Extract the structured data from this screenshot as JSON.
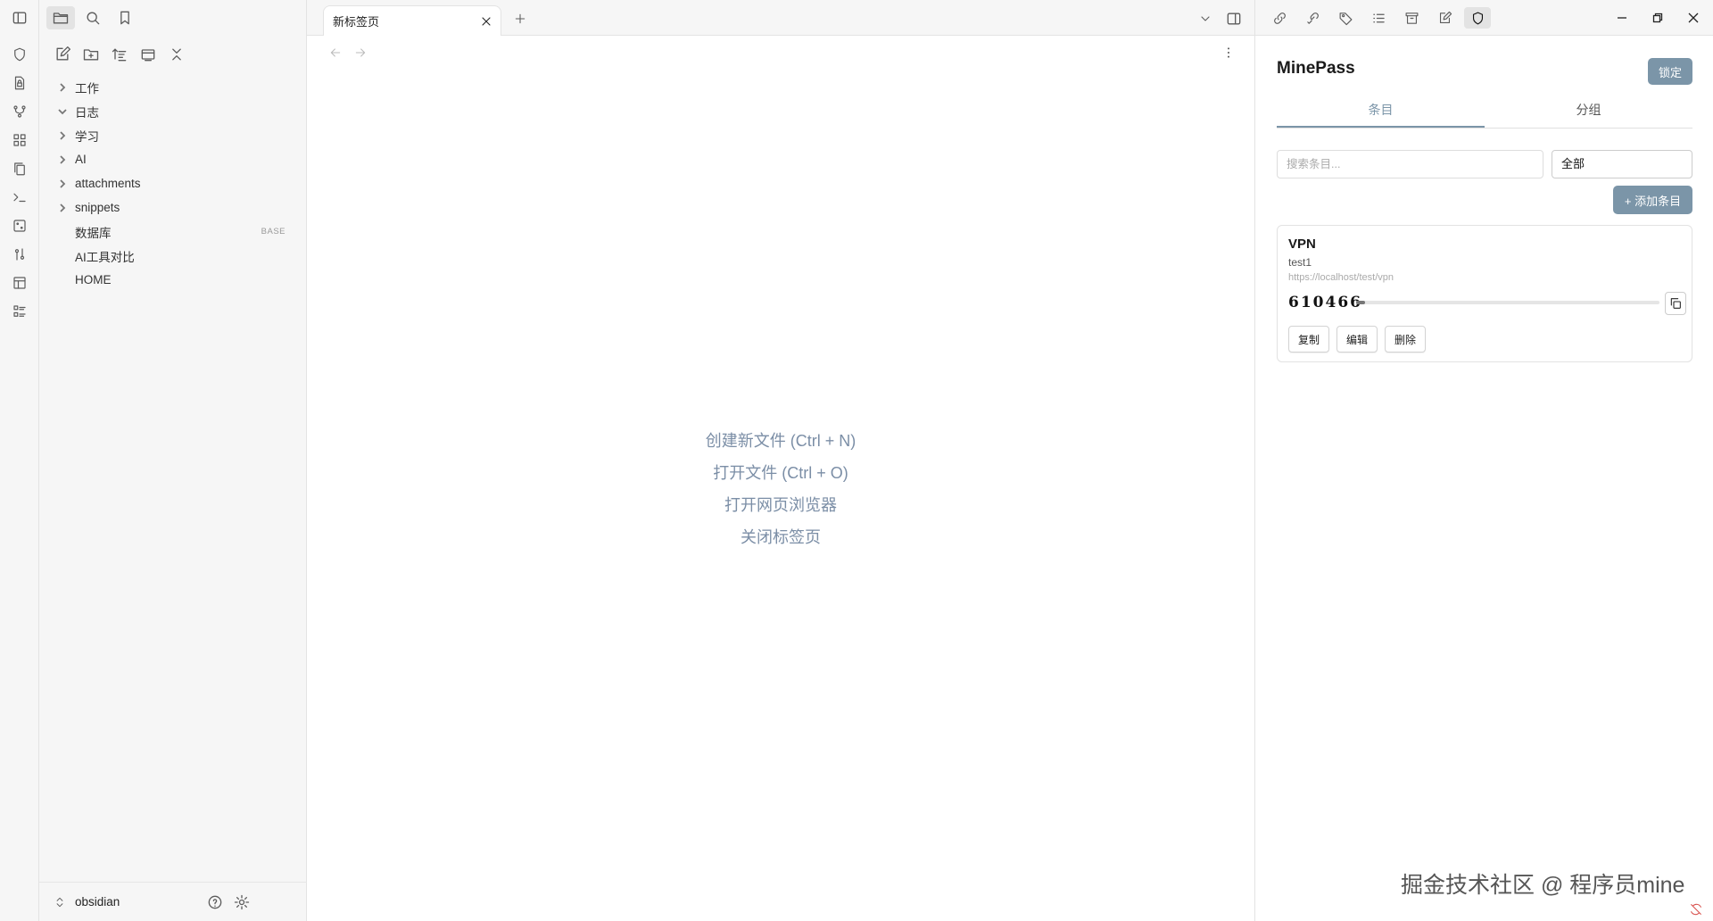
{
  "ribbon": {
    "icons": [
      "shield-outline-icon",
      "file-lock-icon",
      "git-graph-icon",
      "grid-icon",
      "copy-files-icon",
      "terminal-icon",
      "dice-icon",
      "sliders-icon",
      "layout-icon",
      "checklist-icon"
    ]
  },
  "sidebar": {
    "top_icons": [
      "sidebar-toggle-icon",
      "folder-icon",
      "search-icon",
      "bookmark-icon"
    ],
    "action_icons": [
      "new-note-icon",
      "new-folder-icon",
      "sort-icon",
      "collapse-view-icon",
      "collapse-all-icon"
    ],
    "tree": [
      {
        "label": "工作",
        "type": "folder",
        "expanded": false
      },
      {
        "label": "日志",
        "type": "folder",
        "expanded": true
      },
      {
        "label": "学习",
        "type": "folder",
        "expanded": false
      },
      {
        "label": "AI",
        "type": "folder",
        "expanded": false
      },
      {
        "label": "attachments",
        "type": "folder",
        "expanded": false
      },
      {
        "label": "snippets",
        "type": "folder",
        "expanded": false
      },
      {
        "label": "数据库",
        "type": "file",
        "badge": "BASE"
      },
      {
        "label": "AI工具对比",
        "type": "file"
      },
      {
        "label": "HOME",
        "type": "file"
      }
    ],
    "vault_name": "obsidian"
  },
  "main": {
    "tab_title": "新标签页",
    "empty_actions": [
      "创建新文件 (Ctrl + N)",
      "打开文件 (Ctrl + O)",
      "打开网页浏览器",
      "关闭标签页"
    ]
  },
  "right_panel": {
    "top_icons": [
      "link-key-icon",
      "link-check-icon",
      "tag-icon",
      "list-icon",
      "archive-icon",
      "edit-icon",
      "shield-icon"
    ],
    "title": "MinePass",
    "lock_label": "锁定",
    "tabs": [
      "条目",
      "分组"
    ],
    "search_placeholder": "搜索条目...",
    "group_selected": "全部",
    "add_label": "+ 添加条目",
    "entry": {
      "name": "VPN",
      "username": "test1",
      "url": "https://localhost/test/vpn",
      "otp": "610466",
      "otp_progress": 0.03,
      "copy_label": "复制",
      "edit_label": "编辑",
      "delete_label": "删除"
    }
  },
  "watermark": "掘金技术社区 @ 程序员mine",
  "colors": {
    "accent": "#7b95a8",
    "empty_action_text": "#7b8ea6"
  }
}
